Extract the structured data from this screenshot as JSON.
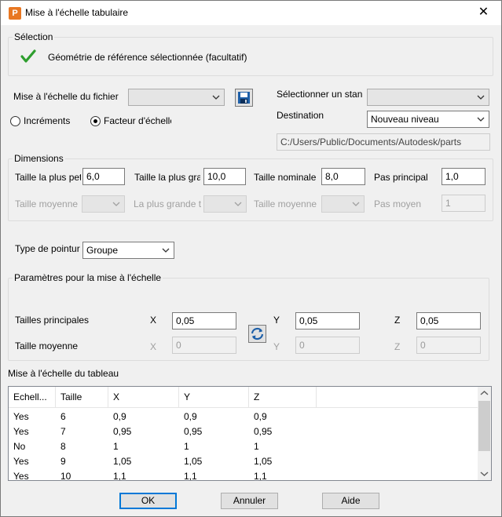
{
  "window": {
    "title": "Mise à l'échelle tabulaire",
    "app_icon_letter": "P",
    "close_label": "✕"
  },
  "selection": {
    "group_label": "Sélection",
    "check_text": "Géométrie de référence sélectionnée (facultatif)"
  },
  "file_scale": {
    "label": "Mise à l'échelle du fichier",
    "combo_value": "",
    "save_icon": "save-icon"
  },
  "standard": {
    "label": "Sélectionner un stan",
    "combo_value": ""
  },
  "destination": {
    "label": "Destination",
    "value": "Nouveau niveau",
    "path": "C:/Users/Public/Documents/Autodesk/parts"
  },
  "mode": {
    "increments_label": "Incréments",
    "factor_label": "Facteur d'échelle",
    "selected": "factor"
  },
  "dimensions": {
    "group_label": "Dimensions",
    "smallest_label": "Taille la plus pet",
    "smallest_value": "6,0",
    "largest_label": "Taille la plus gra",
    "largest_value": "10,0",
    "nominal_label": "Taille nominale",
    "nominal_value": "8,0",
    "main_step_label": "Pas principal",
    "main_step_value": "1,0",
    "avg_size_label": "Taille moyenne",
    "largest_avg_label": "La plus grande t",
    "avg_size2_label": "Taille moyenne",
    "avg_step_label": "Pas moyen",
    "avg_step_value": "1"
  },
  "pointure": {
    "label": "Type de pointur",
    "value": "Groupe"
  },
  "params": {
    "group_label": "Paramètres pour la mise à l'échelle",
    "main_sizes_label": "Tailles principales",
    "avg_size_label": "Taille moyenne",
    "x_label": "X",
    "y_label": "Y",
    "z_label": "Z",
    "x_value": "0,05",
    "y_value": "0,05",
    "z_value": "0,05",
    "x_avg_label": "X",
    "y_avg_label": "Y",
    "z_avg_label": "Z",
    "x_avg_value": "0",
    "y_avg_value": "0",
    "z_avg_value": "0"
  },
  "table": {
    "label": "Mise à l'échelle du tableau",
    "columns": [
      "Echell...",
      "Taille",
      "X",
      "Y",
      "Z"
    ],
    "rows": [
      [
        "Yes",
        "6",
        "0,9",
        "0,9",
        "0,9"
      ],
      [
        "Yes",
        "7",
        "0,95",
        "0,95",
        "0,95"
      ],
      [
        "No",
        "8",
        "1",
        "1",
        "1"
      ],
      [
        "Yes",
        "9",
        "1,05",
        "1,05",
        "1,05"
      ],
      [
        "Yes",
        "10",
        "1,1",
        "1,1",
        "1,1"
      ]
    ]
  },
  "buttons": {
    "ok": "OK",
    "cancel": "Annuler",
    "help": "Aide"
  },
  "colors": {
    "check_green": "#2e9e2e",
    "accent_blue": "#0078d7"
  }
}
